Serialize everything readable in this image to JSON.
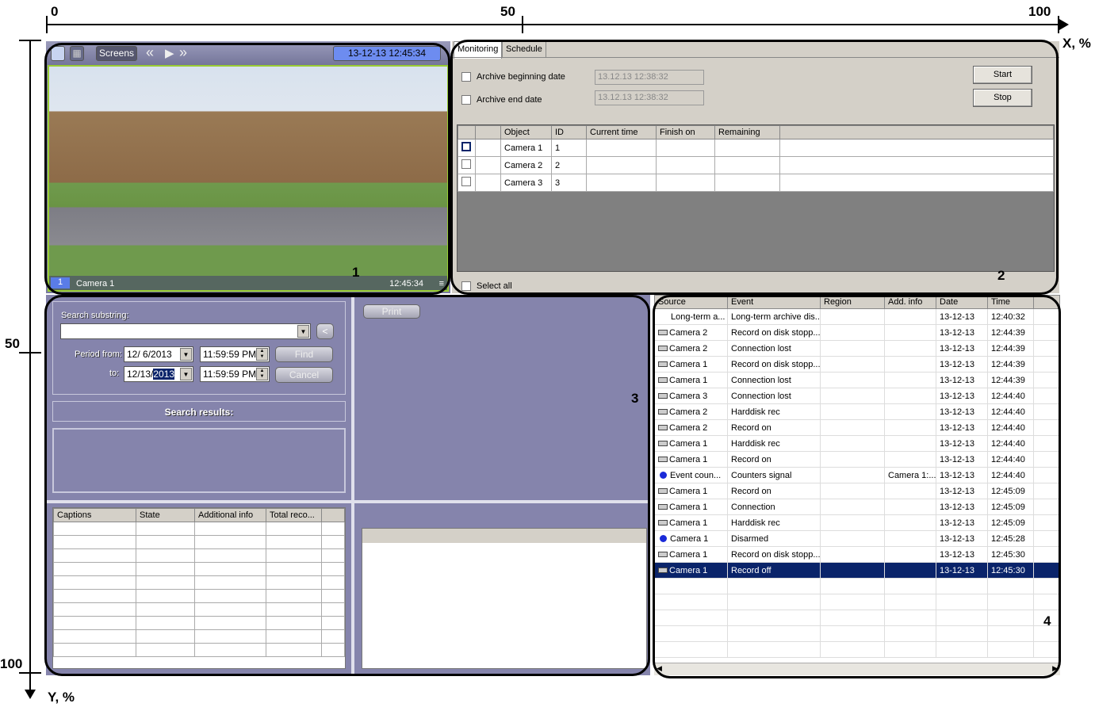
{
  "axes": {
    "x_labels": [
      "0",
      "50",
      "100"
    ],
    "x_title": "X, %",
    "y_labels": [
      "50",
      "100"
    ],
    "y_title": "Y, %"
  },
  "panel_numbers": [
    "1",
    "2",
    "3",
    "4"
  ],
  "video": {
    "screens_label": "Screens",
    "datetime": "13-12-13   12:45:34",
    "camera_num": "1",
    "camera_name": "Camera 1",
    "overlay_time": "12:45:34"
  },
  "archive": {
    "tabs": [
      "Monitoring",
      "Schedule"
    ],
    "begin_label": "Archive beginning date",
    "begin_value": "13.12.13 12:38:32",
    "end_label": "Archive end date",
    "end_value": "13.12.13 12:38:32",
    "start": "Start",
    "stop": "Stop",
    "columns": [
      "",
      "",
      "Object",
      "ID",
      "Current time",
      "Finish on",
      "Remaining"
    ],
    "rows": [
      {
        "object": "Camera 1",
        "id": "1"
      },
      {
        "object": "Camera 2",
        "id": "2"
      },
      {
        "object": "Camera 3",
        "id": "3"
      }
    ],
    "select_all": "Select all"
  },
  "search": {
    "substring_label": "Search substring:",
    "back": "<",
    "period_from": "Period from:",
    "to": "to:",
    "from_date": "12/  6/2013",
    "from_time": "11:59:59 PM",
    "to_date_a": "12/13/",
    "to_date_b": "2013",
    "to_time": "11:59:59 PM",
    "find": "Find",
    "cancel": "Cancel",
    "results": "Search results:",
    "print": "Print",
    "columns": [
      "Captions",
      "State",
      "Additional info",
      "Total reco..."
    ]
  },
  "events": {
    "columns": [
      "Source",
      "Event",
      "Region",
      "Add. info",
      "Date",
      "Time"
    ],
    "rows": [
      {
        "icon": "none",
        "source": "Long-term a...",
        "event": "Long-term archive dis...",
        "region": "",
        "info": "",
        "date": "13-12-13",
        "time": "12:40:32"
      },
      {
        "icon": "camera",
        "source": "Camera 2",
        "event": "Record on disk stopp...",
        "region": "",
        "info": "",
        "date": "13-12-13",
        "time": "12:44:39"
      },
      {
        "icon": "camera",
        "source": "Camera 2",
        "event": "Connection lost",
        "region": "",
        "info": "",
        "date": "13-12-13",
        "time": "12:44:39"
      },
      {
        "icon": "camera",
        "source": "Camera 1",
        "event": "Record on disk stopp...",
        "region": "",
        "info": "",
        "date": "13-12-13",
        "time": "12:44:39"
      },
      {
        "icon": "camera",
        "source": "Camera 1",
        "event": "Connection lost",
        "region": "",
        "info": "",
        "date": "13-12-13",
        "time": "12:44:39"
      },
      {
        "icon": "camera",
        "source": "Camera 3",
        "event": "Connection lost",
        "region": "",
        "info": "",
        "date": "13-12-13",
        "time": "12:44:40"
      },
      {
        "icon": "camera",
        "source": "Camera 2",
        "event": "Harddisk rec",
        "region": "",
        "info": "",
        "date": "13-12-13",
        "time": "12:44:40"
      },
      {
        "icon": "camera",
        "source": "Camera 2",
        "event": "Record on",
        "region": "",
        "info": "",
        "date": "13-12-13",
        "time": "12:44:40"
      },
      {
        "icon": "camera",
        "source": "Camera 1",
        "event": "Harddisk rec",
        "region": "",
        "info": "",
        "date": "13-12-13",
        "time": "12:44:40"
      },
      {
        "icon": "camera",
        "source": "Camera 1",
        "event": "Record on",
        "region": "",
        "info": "",
        "date": "13-12-13",
        "time": "12:44:40"
      },
      {
        "icon": "dot",
        "source": "Event coun...",
        "event": "Counters signal",
        "region": "",
        "info": "Camera 1:...",
        "date": "13-12-13",
        "time": "12:44:40"
      },
      {
        "icon": "camera",
        "source": "Camera 1",
        "event": "Record on",
        "region": "",
        "info": "",
        "date": "13-12-13",
        "time": "12:45:09"
      },
      {
        "icon": "camera",
        "source": "Camera 1",
        "event": "Connection",
        "region": "",
        "info": "",
        "date": "13-12-13",
        "time": "12:45:09"
      },
      {
        "icon": "camera",
        "source": "Camera 1",
        "event": "Harddisk rec",
        "region": "",
        "info": "",
        "date": "13-12-13",
        "time": "12:45:09"
      },
      {
        "icon": "dot",
        "source": "Camera 1",
        "event": "Disarmed",
        "region": "",
        "info": "",
        "date": "13-12-13",
        "time": "12:45:28"
      },
      {
        "icon": "camera",
        "source": "Camera 1",
        "event": "Record on disk stopp...",
        "region": "",
        "info": "",
        "date": "13-12-13",
        "time": "12:45:30"
      },
      {
        "icon": "camera",
        "source": "Camera 1",
        "event": "Record off",
        "region": "",
        "info": "",
        "date": "13-12-13",
        "time": "12:45:30",
        "selected": true
      }
    ]
  }
}
